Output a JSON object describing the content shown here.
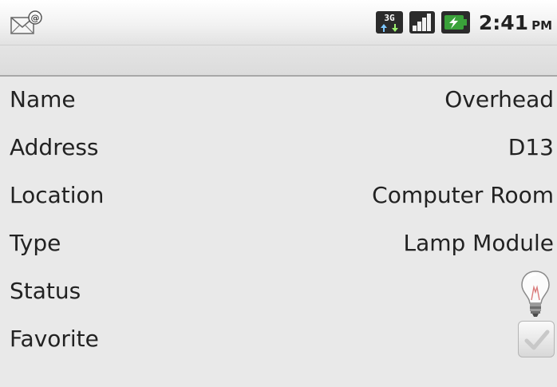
{
  "status_bar": {
    "time": "2:41",
    "ampm": "PM",
    "network_label": "3G",
    "notification_icon": "email-notification-icon",
    "signal_icon": "signal-strength-icon",
    "battery_icon": "battery-charging-icon"
  },
  "details": {
    "rows": [
      {
        "label": "Name",
        "value": "Overhead"
      },
      {
        "label": "Address",
        "value": "D13"
      },
      {
        "label": "Location",
        "value": "Computer Room"
      },
      {
        "label": "Type",
        "value": "Lamp Module"
      },
      {
        "label": "Status",
        "icon": "light-bulb-off-icon"
      },
      {
        "label": "Favorite",
        "checked": true
      }
    ]
  },
  "colors": {
    "text": "#222222",
    "background": "#e9e9e9",
    "battery_green": "#3aa23a"
  }
}
